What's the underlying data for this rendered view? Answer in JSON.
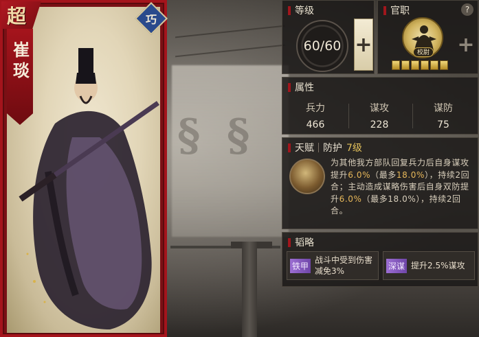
{
  "hero": {
    "rarity": "超",
    "name": "崔琰",
    "type": "巧"
  },
  "level": {
    "title": "等级",
    "current": 60,
    "max": 60,
    "display": "60/60",
    "add_icon": "plus-icon"
  },
  "rank": {
    "title": "官职",
    "badge_label": "校尉",
    "pips": 6,
    "add_icon": "plus-icon",
    "help_label": "?"
  },
  "attributes": {
    "title": "属性",
    "items": [
      {
        "label": "兵力",
        "value": "466"
      },
      {
        "label": "谋攻",
        "value": "228"
      },
      {
        "label": "谋防",
        "value": "75"
      }
    ]
  },
  "talent": {
    "title": "天赋",
    "category": "防护",
    "level": "7级",
    "desc_parts": [
      "为其他我方部队回复兵力后自身谋攻提升",
      "6.0%",
      "（最多",
      "18.0%",
      "），持续2回合；主动造成谋略伤害后自身双防提升",
      "6.0%",
      "（最多18.0%），持续2回合。"
    ]
  },
  "strategies": {
    "title": "韬略",
    "items": [
      {
        "tag": "铁甲",
        "text": "战斗中受到伤害减免3%"
      },
      {
        "tag": "深谋",
        "text": "提升2.5%谋攻"
      }
    ]
  },
  "colors": {
    "card_red": "#a4141c",
    "panel_bg": "#1c1a18",
    "highlight": "#e8b85a",
    "level_gold": "#e3c15c",
    "strategy_purple": "#8a5ec4"
  }
}
